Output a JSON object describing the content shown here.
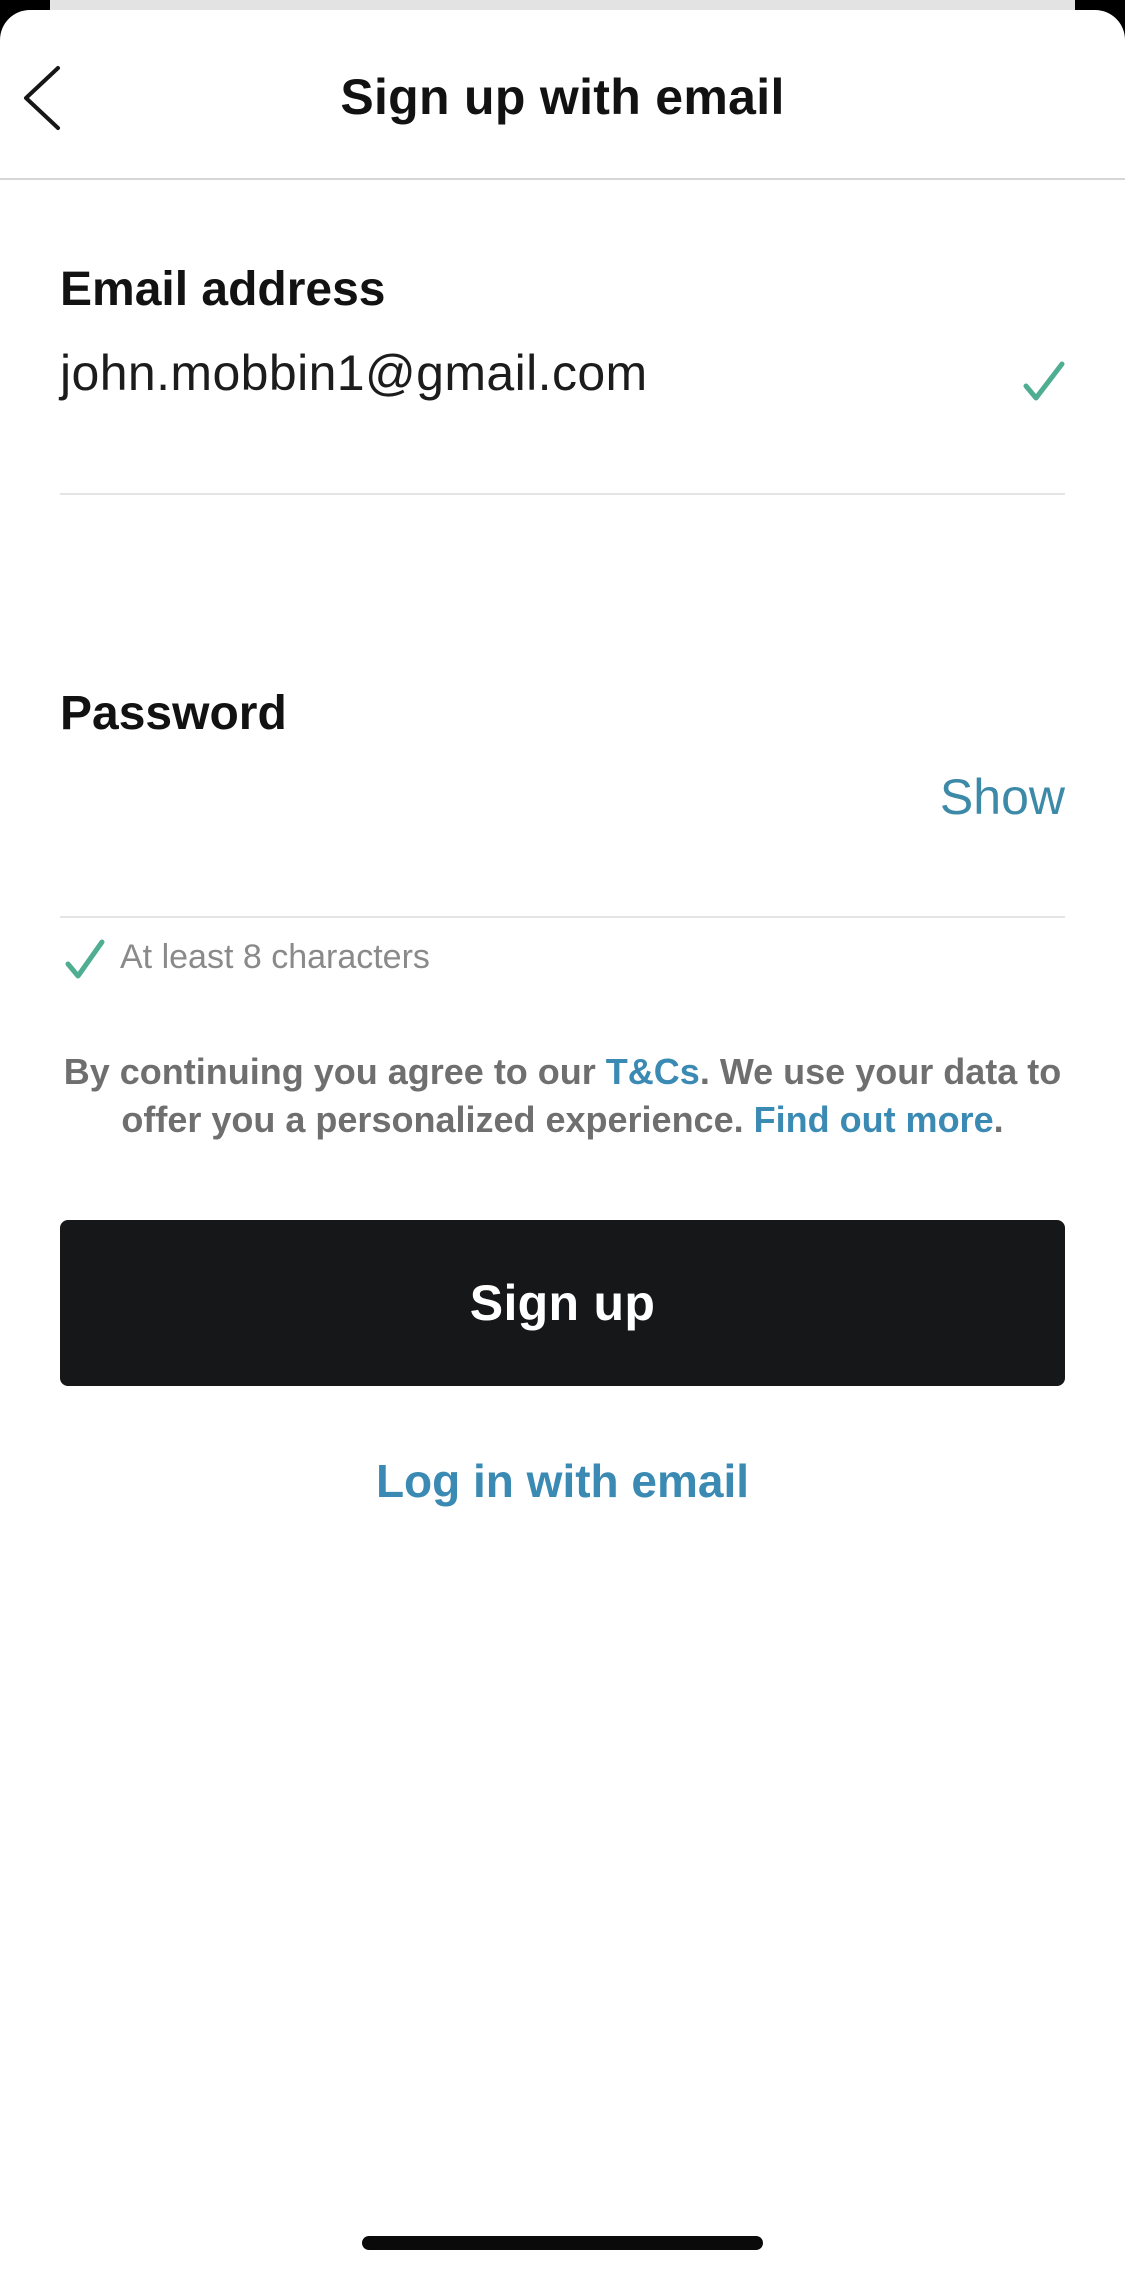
{
  "header": {
    "title": "Sign up with email"
  },
  "email": {
    "label": "Email address",
    "value": "john.mobbin1@gmail.com",
    "valid_icon": "check-icon"
  },
  "password": {
    "label": "Password",
    "value": "",
    "show_label": "Show",
    "rule": "At least 8 characters",
    "rule_icon": "check-icon"
  },
  "terms": {
    "prefix": "By continuing you agree to our ",
    "tcs_link": "T&Cs",
    "middle": ".  We use your data to offer you a personalized experience. ",
    "more_link": "Find out more",
    "suffix": "."
  },
  "actions": {
    "signup_label": "Sign up",
    "login_label": "Log in with email"
  },
  "colors": {
    "accent": "#3a8ab3",
    "check": "#4fae92",
    "button_bg": "#161719"
  }
}
